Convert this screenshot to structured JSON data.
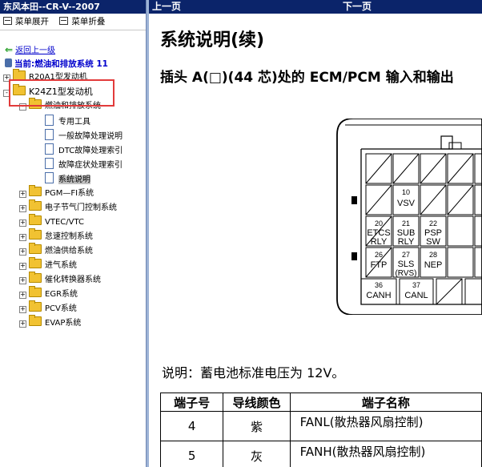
{
  "app": {
    "title": "东风本田--CR-V--2007"
  },
  "menu": {
    "expand": "菜单展开",
    "collapse": "菜单折叠"
  },
  "tree": {
    "back": "返回上一级",
    "current": "当前:燃油和排放系统 11",
    "nodes": [
      {
        "label": "R20A1型发动机",
        "pm": "+"
      },
      {
        "label": "K24Z1型发动机",
        "pm": "-"
      },
      {
        "label": "燃油和排放系统",
        "pm": "-"
      },
      {
        "label": "专用工具"
      },
      {
        "label": "一般故障处理说明"
      },
      {
        "label": "DTC故障处理索引"
      },
      {
        "label": "故障症状处理索引"
      },
      {
        "label": "系统说明"
      },
      {
        "label": "PGM—FI系统",
        "pm": "+"
      },
      {
        "label": "电子节气门控制系统",
        "pm": "+"
      },
      {
        "label": "VTEC/VTC",
        "pm": "+"
      },
      {
        "label": "怠速控制系统",
        "pm": "+"
      },
      {
        "label": "燃油供给系统",
        "pm": "+"
      },
      {
        "label": "进气系统",
        "pm": "+"
      },
      {
        "label": "催化转换器系统",
        "pm": "+"
      },
      {
        "label": "EGR系统",
        "pm": "+"
      },
      {
        "label": "PCV系统",
        "pm": "+"
      },
      {
        "label": "EVAP系统",
        "pm": "+"
      }
    ]
  },
  "nav": {
    "prev": "上一页",
    "next": "下一页"
  },
  "doc": {
    "title": "系统说明(续)",
    "subtitle": "插头 A(□)(44 芯)处的 ECM/PCM 输入和输出",
    "note": "说明：蓄电池标准电压为 12V。"
  },
  "connector": {
    "pins": [
      {
        "num": "10",
        "l1": "VSV",
        "l2": ""
      },
      {
        "num": "20",
        "l1": "ETCS",
        "l2": "RLY"
      },
      {
        "num": "21",
        "l1": "SUB",
        "l2": "RLY"
      },
      {
        "num": "22",
        "l1": "PSP",
        "l2": "SW"
      },
      {
        "num": "26",
        "l1": "FTP",
        "l2": ""
      },
      {
        "num": "27",
        "l1": "SLS",
        "l2": "(RVS)"
      },
      {
        "num": "28",
        "l1": "NEP",
        "l2": ""
      },
      {
        "num": "36",
        "l1": "CANH",
        "l2": ""
      },
      {
        "num": "37",
        "l1": "CANL",
        "l2": ""
      }
    ]
  },
  "table": {
    "headers": [
      "端子号",
      "导线颜色",
      "端子名称"
    ],
    "rows": [
      [
        "4",
        "紫",
        "FANL(散热器风扇控制)"
      ],
      [
        "5",
        "灰",
        "FANH(散热器风扇控制)"
      ]
    ]
  }
}
